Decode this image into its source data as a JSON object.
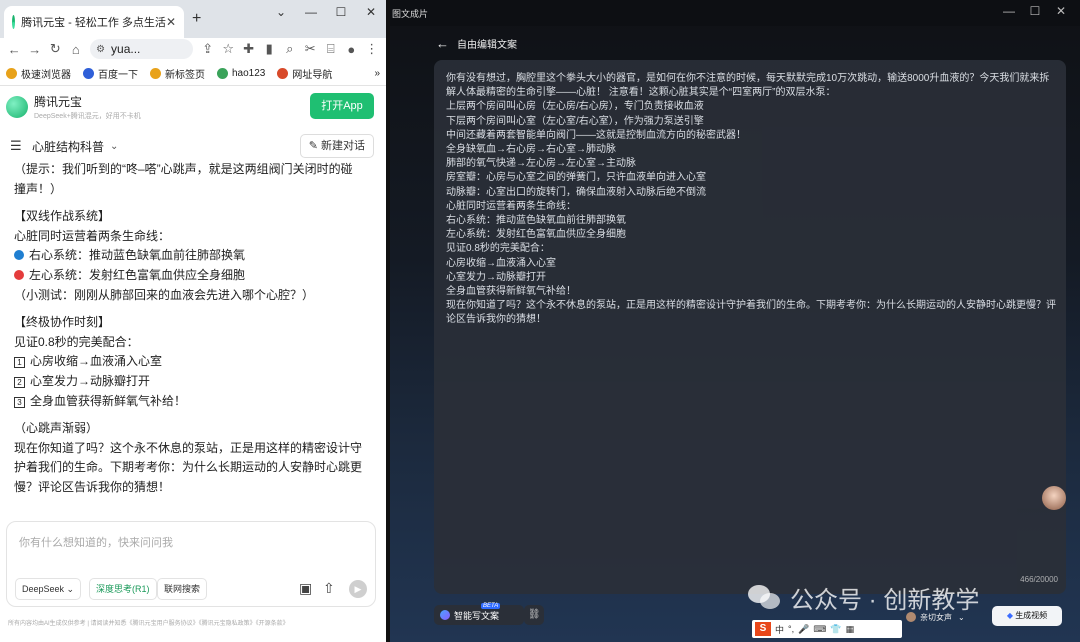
{
  "browser": {
    "tab_title": "腾讯元宝 - 轻松工作 多点生活",
    "address": "yua...",
    "bookmarks": [
      "极速浏览器",
      "百度一下",
      "新标签页",
      "hao123",
      "网址导航"
    ]
  },
  "app": {
    "name": "腾讯元宝",
    "tagline": "DeepSeek+腾讯混元，好用不卡机",
    "open_app": "打开App",
    "chat_title": "心脏结构科普",
    "new_chat": "新建对话"
  },
  "chat": {
    "lines": [
      "（提示：我们听到的“咚–嗒”心跳声，就是这两组阀门关闭时的碰",
      "撞声！）",
      "【双线作战系统】",
      "心脏同时运营着两条生命线：",
      "右心系统：推动蓝色缺氧血前往肺部换氧",
      "左心系统：发射红色富氧血供应全身细胞",
      "（小测试：刚刚从肺部回来的血液会先进入哪个心腔？）",
      "【终极协作时刻】",
      "见证0.8秒的完美配合：",
      "心房收缩→血液涌入心室",
      "心室发力→动脉瓣打开",
      "全身血管获得新鲜氧气补给！",
      "（心跳声渐弱）",
      "现在你知道了吗？这个永不休息的泵站，正是用这样的精密设计守",
      "护着我们的生命。下期考考你：为什么长期运动的人安静时心跳更",
      "慢？评论区告诉我你的猜想！"
    ],
    "num_marks": [
      "1",
      "2",
      "3"
    ],
    "dot_colors": {
      "right": "#1f7fd1",
      "left": "#e43c3c"
    }
  },
  "input": {
    "placeholder": "你有什么想知道的，快来问问我",
    "model": "DeepSeek",
    "deep_think": "深度思考(R1)",
    "web_search": "联网搜索"
  },
  "footer": "所有内容均由AI生成仅供参考 | 请阅读并知悉《腾讯元宝用户服务协议》《腾讯元宝隐私政策》《开源条款》",
  "right": {
    "window_title": "图文成片",
    "header": "自由编辑文案",
    "paragraphs": [
      "你有没有想过，胸腔里这个拳头大小的器官，是如何在你不注意的时候，每天默默完成10万次跳动，输送8000升血液的？今天我们就来拆解人体最精密的生命引擎——心脏！  注意看！这颗心脏其实是个“四室两厅”的双层水泵：",
      "上层两个房间叫心房（左心房/右心房），专门负责接收血液",
      "下层两个房间叫心室（左心室/右心室），作为强力泵送引擎",
      "中间还藏着两套智能单向阀门——这就是控制血流方向的秘密武器！",
      "全身缺氧血→右心房→右心室→肺动脉",
      "肺部的氧气快递→左心房→左心室→主动脉",
      "房室瓣：心房与心室之间的弹簧门，只许血液单向进入心室",
      "动脉瓣：心室出口的旋转门，确保血液射入动脉后绝不倒流",
      "心脏同时运营着两条生命线：",
      "右心系统：推动蓝色缺氧血前往肺部换氧",
      "左心系统：发射红色富氧血供应全身细胞",
      "见证0.8秒的完美配合：",
      "心房收缩→血液涌入心室",
      "心室发力→动脉瓣打开",
      "全身血管获得新鲜氧气补给！",
      "现在你知道了吗？这个永不休息的泵站，正是用这样的精密设计守护着我们的生命。下期考考你：为什么长期运动的人安静时心跳更慢？评论区告诉我你的猜想！"
    ],
    "counter": "466/20000",
    "ai_write": "智能写文案",
    "beta": "BETA",
    "voice": "亲切女声",
    "generate_video": "生成视频"
  },
  "watermark": "公众号 · 创新教学",
  "ime": [
    "中",
    "°,"
  ]
}
